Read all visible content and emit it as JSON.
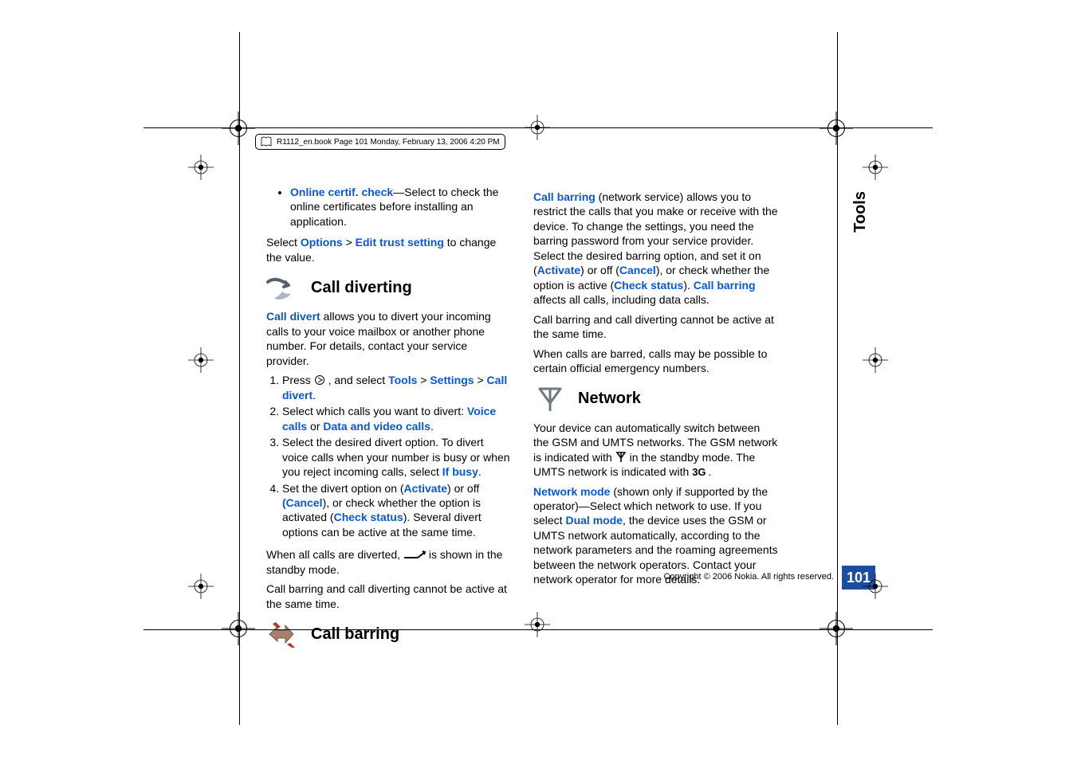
{
  "header_box": "R1112_en.book  Page 101  Monday, February 13, 2006  4:20 PM",
  "side_tab": "Tools",
  "page_number": "101",
  "copyright": "Copyright © 2006 Nokia. All rights reserved.",
  "left": {
    "bullet_label": "Online certif. check",
    "bullet_rest": "—Select to check the online certificates before installing an application.",
    "select1_a": "Select ",
    "select1_b": "Options",
    "select1_c": " > ",
    "select1_d": "Edit trust setting",
    "select1_e": " to change the value.",
    "h_divert": "Call diverting",
    "divert_intro_a": "Call divert",
    "divert_intro_b": " allows you to divert your incoming calls to your voice mailbox or another phone number. For details, contact your service provider.",
    "step1_a": "Press ",
    "step1_b": " , and select ",
    "step1_c": "Tools",
    "step1_d": " > ",
    "step1_e": "Settings",
    "step1_f": " > ",
    "step1_g": "Call divert",
    "step1_h": ".",
    "step2_a": "Select which calls you want to divert: ",
    "step2_b": "Voice calls",
    "step2_c": " or ",
    "step2_d": "Data and video calls",
    "step2_e": ".",
    "step3_a": "Select the desired divert option. To divert voice calls when your number is busy or when you reject incoming calls, select ",
    "step3_b": "If busy",
    "step3_c": ".",
    "step4_a": "Set the divert option on (",
    "step4_b": "Activate",
    "step4_c": ") or off ",
    "step4_d": "(Cancel",
    "step4_e": "), or check whether the option is activated (",
    "step4_f": "Check status",
    "step4_g": "). Several divert options can be active at the same time.",
    "divert_note_a": "When all calls are diverted, ",
    "divert_note_b": " is shown in the standby mode.",
    "divert_bar": "Call barring and call diverting cannot be active at the same time.",
    "h_barring": "Call barring"
  },
  "right": {
    "barring_intro_a": "Call barring",
    "barring_intro_b": " (network service) allows you to restrict the calls that you make or receive with the device. To change the settings, you need the barring password from your service provider. Select the desired barring option, and set it on (",
    "barring_intro_c": "Activate",
    "barring_intro_d": ") or off (",
    "barring_intro_e": "Cancel",
    "barring_intro_f": "), or check whether the option is active (",
    "barring_intro_g": "Check status",
    "barring_intro_h": "). ",
    "barring_intro_i": "Call barring",
    "barring_intro_j": " affects all calls, including data calls.",
    "barring_note": "Call barring and call diverting cannot be active at the same time.",
    "barring_emerg": "When calls are barred, calls may be possible to certain official emergency numbers.",
    "h_network": "Network",
    "net_intro_a": "Your device can automatically switch between the GSM and UMTS networks. The GSM network is indicated with ",
    "net_intro_b": " in the standby mode. The UMTS network is indicated with ",
    "net_intro_c": ".",
    "g3": "3G",
    "netmode_a": "Network mode",
    "netmode_b": " (shown only if supported by the operator)—Select which network to use. If you select ",
    "netmode_c": "Dual mode",
    "netmode_d": ", the device uses the GSM or UMTS network automatically, according to the network parameters and the roaming agreements between the network operators. Contact your network operator for more details."
  }
}
